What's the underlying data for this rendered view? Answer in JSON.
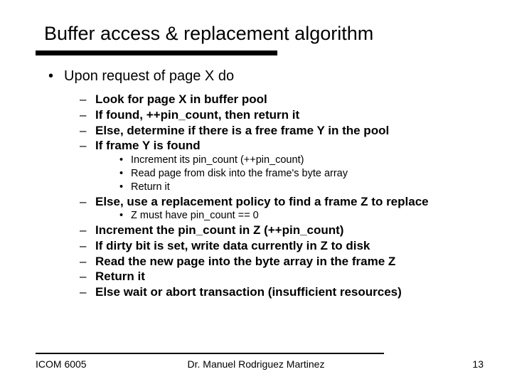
{
  "title": "Buffer access & replacement algorithm",
  "l1": "Upon request of page X do",
  "l2a": [
    "Look for page X in buffer pool",
    "If found, ++pin_count, then return it",
    "Else, determine if there is a free frame Y in the pool",
    "If frame Y is found"
  ],
  "l3a": [
    "Increment its pin_count (++pin_count)",
    "Read page from disk into the frame's byte array",
    "Return it"
  ],
  "l2b": [
    "Else, use a replacement policy to find a frame Z to replace"
  ],
  "l3b": [
    "Z must have pin_count == 0"
  ],
  "l2c": [
    "Increment the pin_count in Z (++pin_count)",
    "If dirty bit is set, write data currently in Z to disk",
    "Read the new page into the byte array in the frame Z",
    "Return it",
    "Else wait or abort transaction (insufficient resources)"
  ],
  "footer": {
    "left": "ICOM 6005",
    "center": "Dr. Manuel Rodriguez Martinez",
    "right": "13"
  }
}
